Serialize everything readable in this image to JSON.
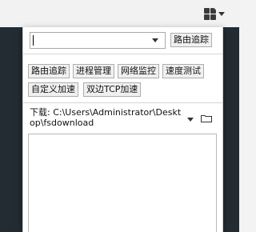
{
  "toolbar": {
    "extension_icon": "grid-icon",
    "extension_menu_icon": "chevron-down-icon"
  },
  "route_trace": {
    "input_value": "",
    "dropdown_icon": "chevron-down-icon",
    "button_label": "路由追踪"
  },
  "tools": {
    "route_trace": "路由追踪",
    "process_manager": "进程管理",
    "network_monitor": "网络监控",
    "speed_test": "速度测试",
    "custom_accel": "自定义加速",
    "dual_tcp_accel": "双边TCP加速"
  },
  "download": {
    "label_path": "下载: C:\\Users\\Administrator\\Desktop\\fsdownload",
    "dropdown_icon": "chevron-down-icon",
    "folder_icon": "folder-icon"
  },
  "colors": {
    "dark_band": "#232b33",
    "panel_bg": "#ffffff",
    "button_bg": "#f0f0f0"
  }
}
